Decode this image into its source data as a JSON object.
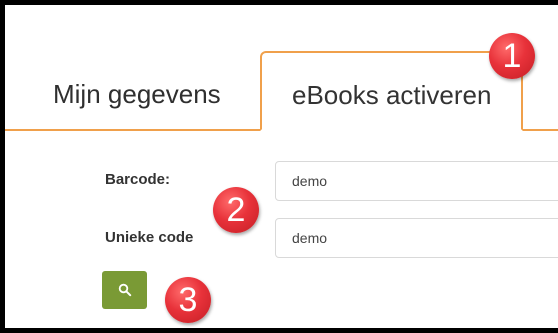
{
  "tabs": [
    {
      "label": "Mijn gegevens",
      "active": false
    },
    {
      "label": "eBooks activeren",
      "active": true
    }
  ],
  "form": {
    "barcode": {
      "label": "Barcode:",
      "value": "demo"
    },
    "unieke_code": {
      "label": "Unieke code",
      "value": "demo"
    }
  },
  "search_button": {
    "icon": "search-icon"
  },
  "badges": [
    "1",
    "2",
    "3"
  ],
  "colors": {
    "accent": "#f0a04b",
    "button": "#7a9a35",
    "badge": "#e8323a"
  }
}
